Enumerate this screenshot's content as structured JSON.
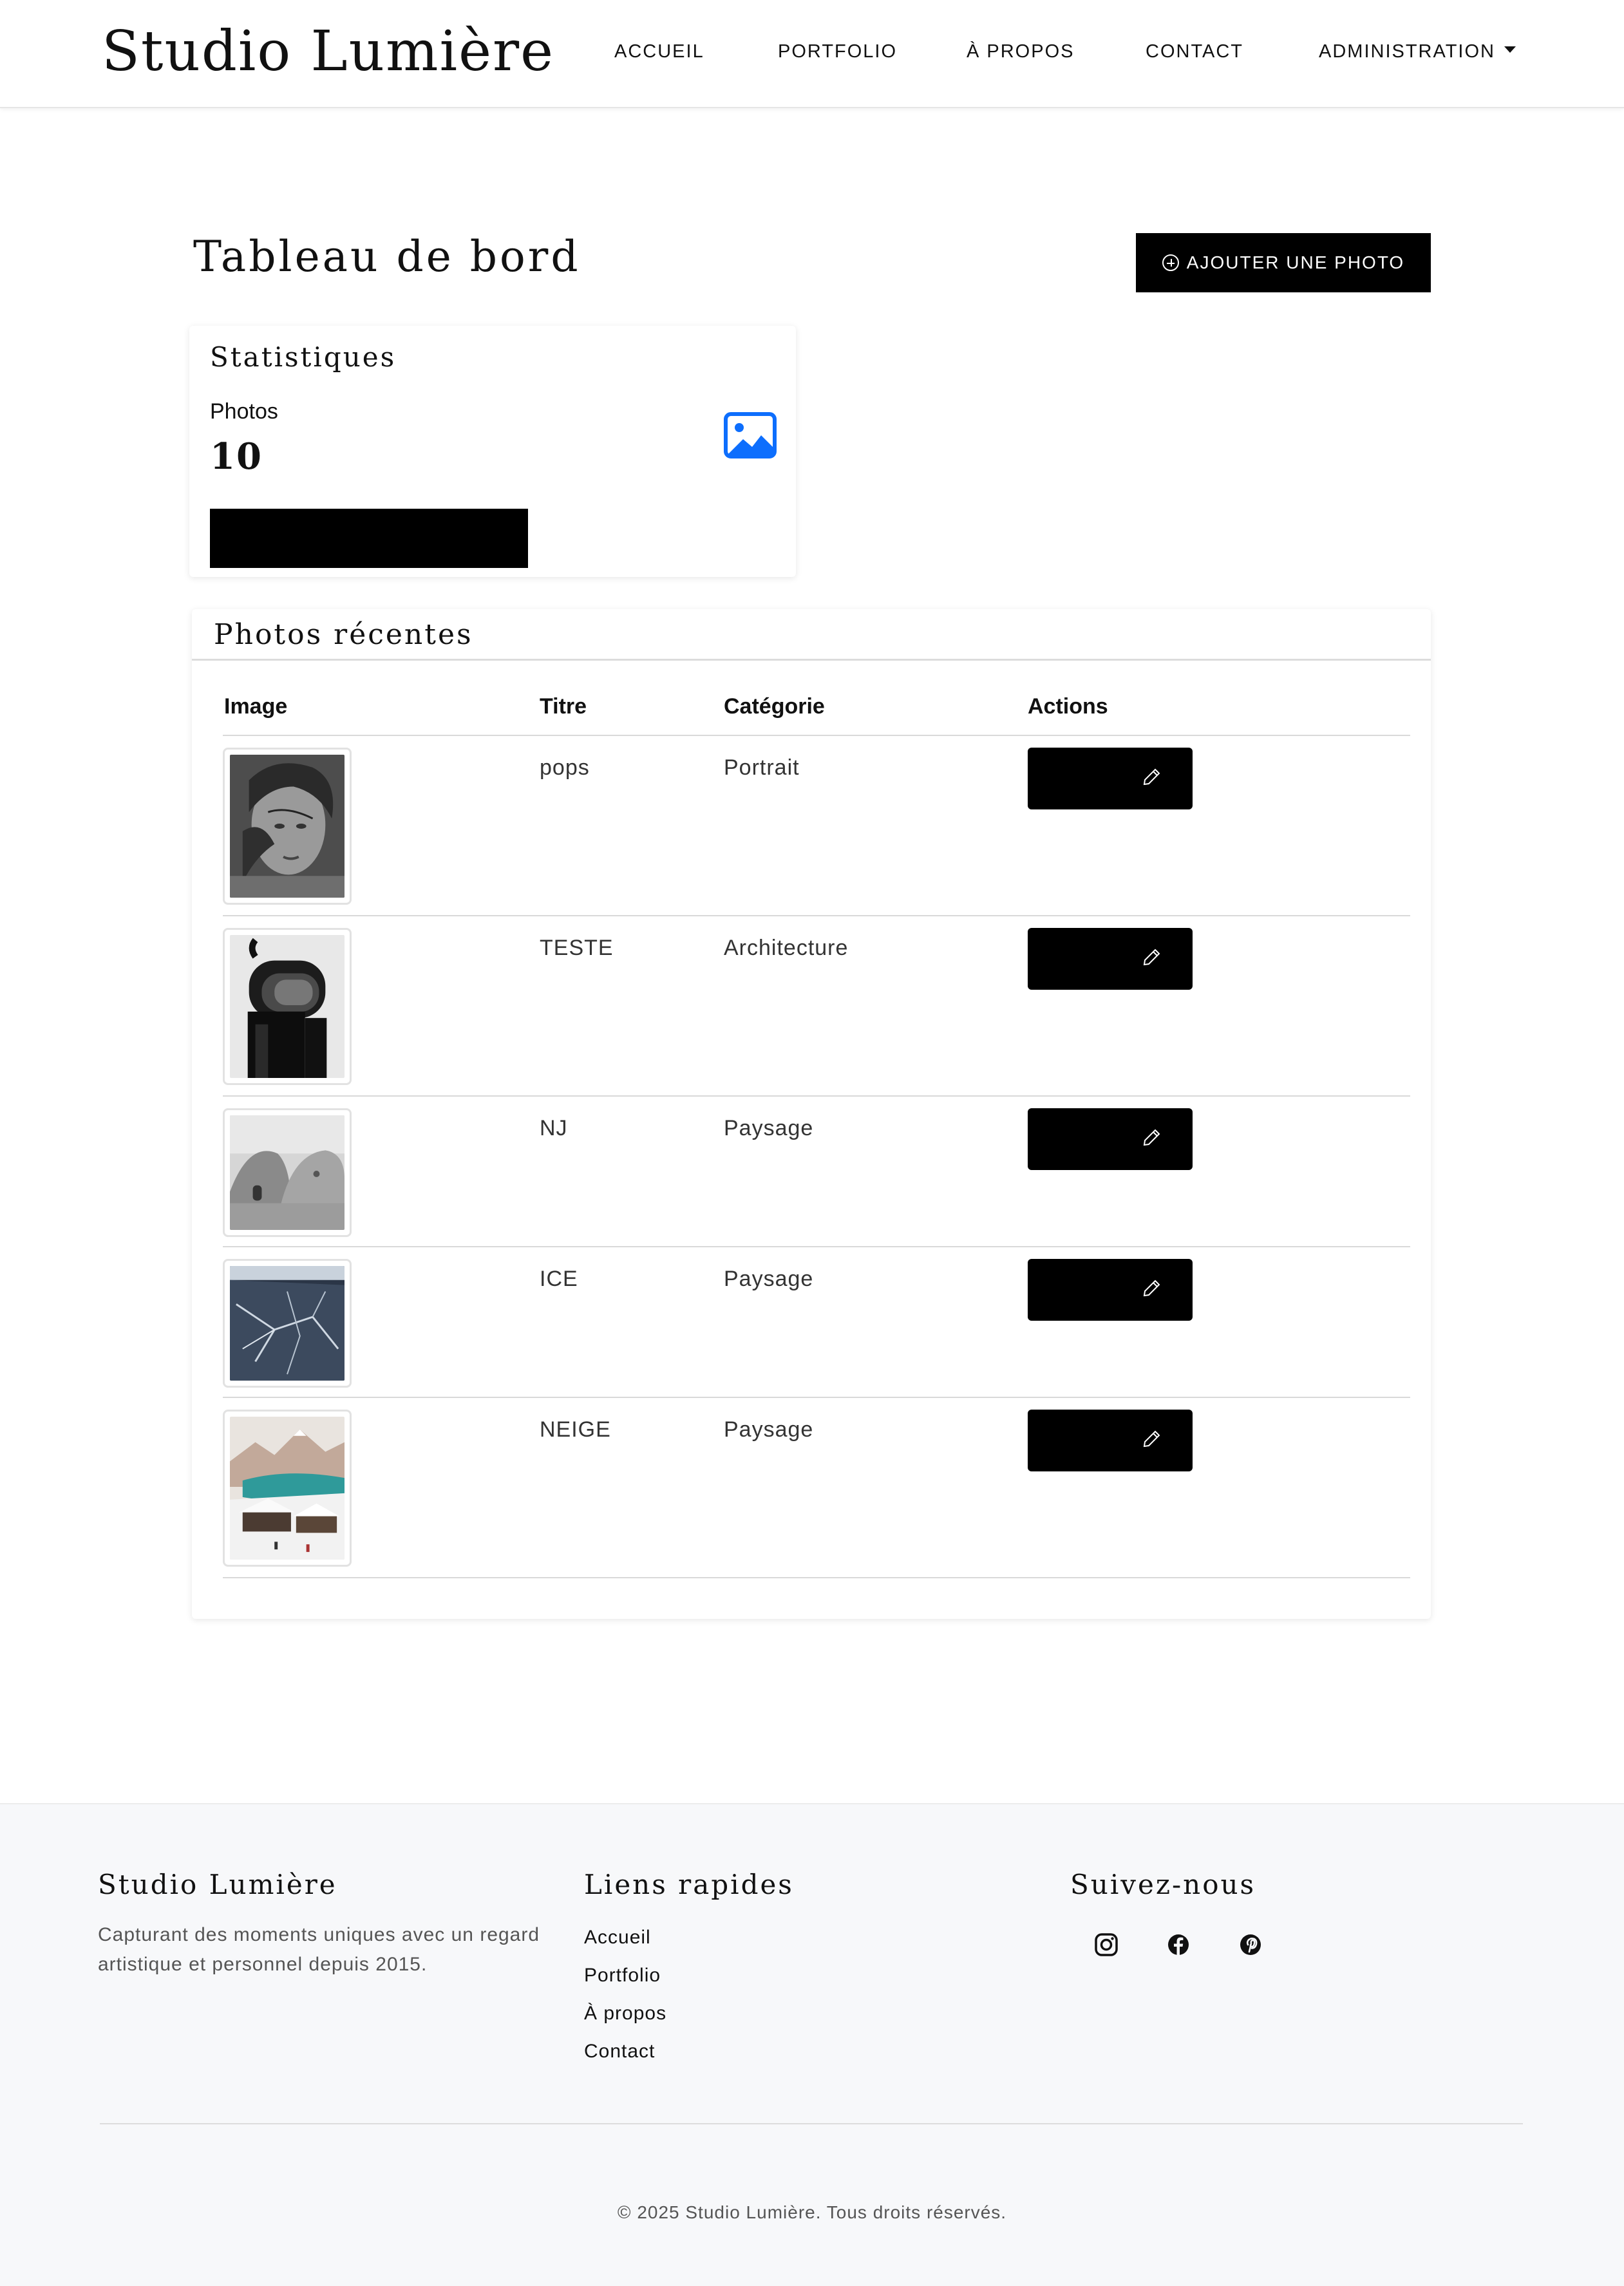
{
  "navbar": {
    "brand": "Studio Lumière",
    "links": [
      "ACCUEIL",
      "PORTFOLIO",
      "À PROPOS",
      "CONTACT",
      "ADMINISTRATION"
    ]
  },
  "page": {
    "title": "Tableau de bord",
    "add_button": "AJOUTER UNE PHOTO"
  },
  "stats": {
    "title": "Statistiques",
    "label": "Photos",
    "value": "10",
    "icon": "image-icon",
    "icon_color": "#0d6efd"
  },
  "recent": {
    "title": "Photos récentes",
    "columns": [
      "Image",
      "Titre",
      "Catégorie",
      "Actions"
    ],
    "rows": [
      {
        "title": "pops",
        "category": "Portrait"
      },
      {
        "title": "TESTE",
        "category": "Architecture"
      },
      {
        "title": "NJ",
        "category": "Paysage"
      },
      {
        "title": "ICE",
        "category": "Paysage"
      },
      {
        "title": "NEIGE",
        "category": "Paysage"
      }
    ]
  },
  "footer": {
    "about_title": "Studio Lumière",
    "about_text": "Capturant des moments uniques avec un regard artistique et personnel depuis 2015.",
    "links_title": "Liens rapides",
    "links": [
      "Accueil",
      "Portfolio",
      "À propos",
      "Contact"
    ],
    "social_title": "Suivez-nous",
    "social_icons": [
      "instagram-icon",
      "facebook-icon",
      "pinterest-icon"
    ],
    "copyright": "© 2025 Studio Lumière. Tous droits réservés."
  }
}
